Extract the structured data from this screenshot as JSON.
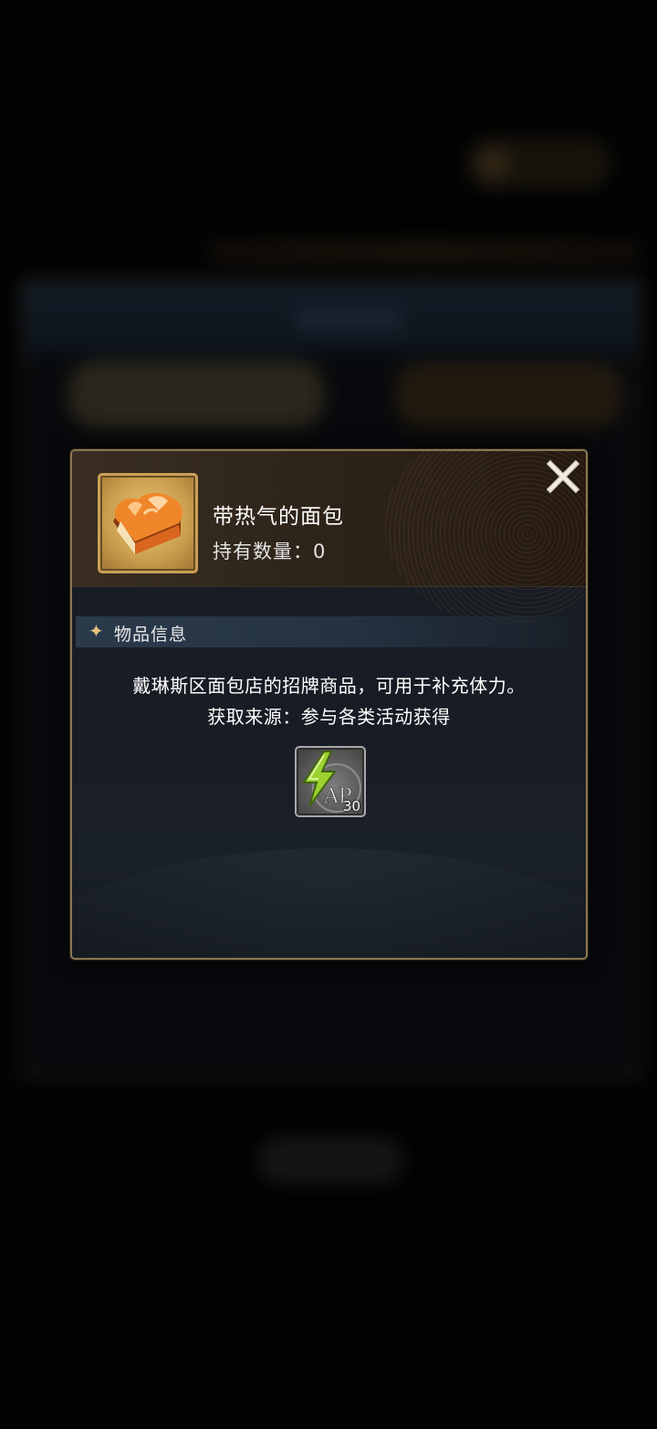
{
  "item": {
    "name": "带热气的面包",
    "count_label": "持有数量：0",
    "icon": "bread-icon"
  },
  "section": {
    "title": "物品信息"
  },
  "description": {
    "line1": "戴琳斯区面包店的招牌商品，可用于补充体力。",
    "line2": "获取来源：参与各类活动获得"
  },
  "reward": {
    "icon": "ap-lightning-icon",
    "label": "AP",
    "amount": "30"
  },
  "colors": {
    "gold_border": "#8a7653",
    "header_bg": "#2e2419",
    "section_bar": "#2b3a4b",
    "item_frame": "#c9a056"
  }
}
